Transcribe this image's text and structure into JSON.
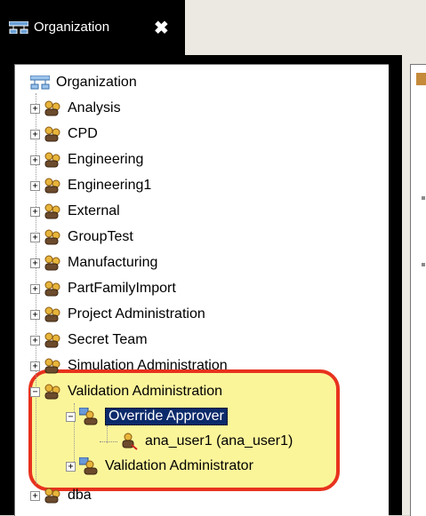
{
  "tab": {
    "title": "Organization",
    "close_symbol": "✖"
  },
  "tree": {
    "root": "Organization",
    "groups": [
      "Analysis",
      "CPD",
      "Engineering",
      "Engineering1",
      "External",
      "GroupTest",
      "Manufacturing",
      "PartFamilyImport",
      "Project Administration",
      "Secret Team",
      "Simulation Administration"
    ],
    "expanded_group": "Validation Administration",
    "role_selected": "Override Approver",
    "user": "ana_user1 (ana_user1)",
    "role_other": "Validation Administrator",
    "after_group": "dba"
  },
  "expander": {
    "plus": "+",
    "minus": "−"
  },
  "colors": {
    "selection": "#0b2a6b",
    "highlight_fill": "#fbf59a",
    "highlight_border": "#e8321e"
  }
}
